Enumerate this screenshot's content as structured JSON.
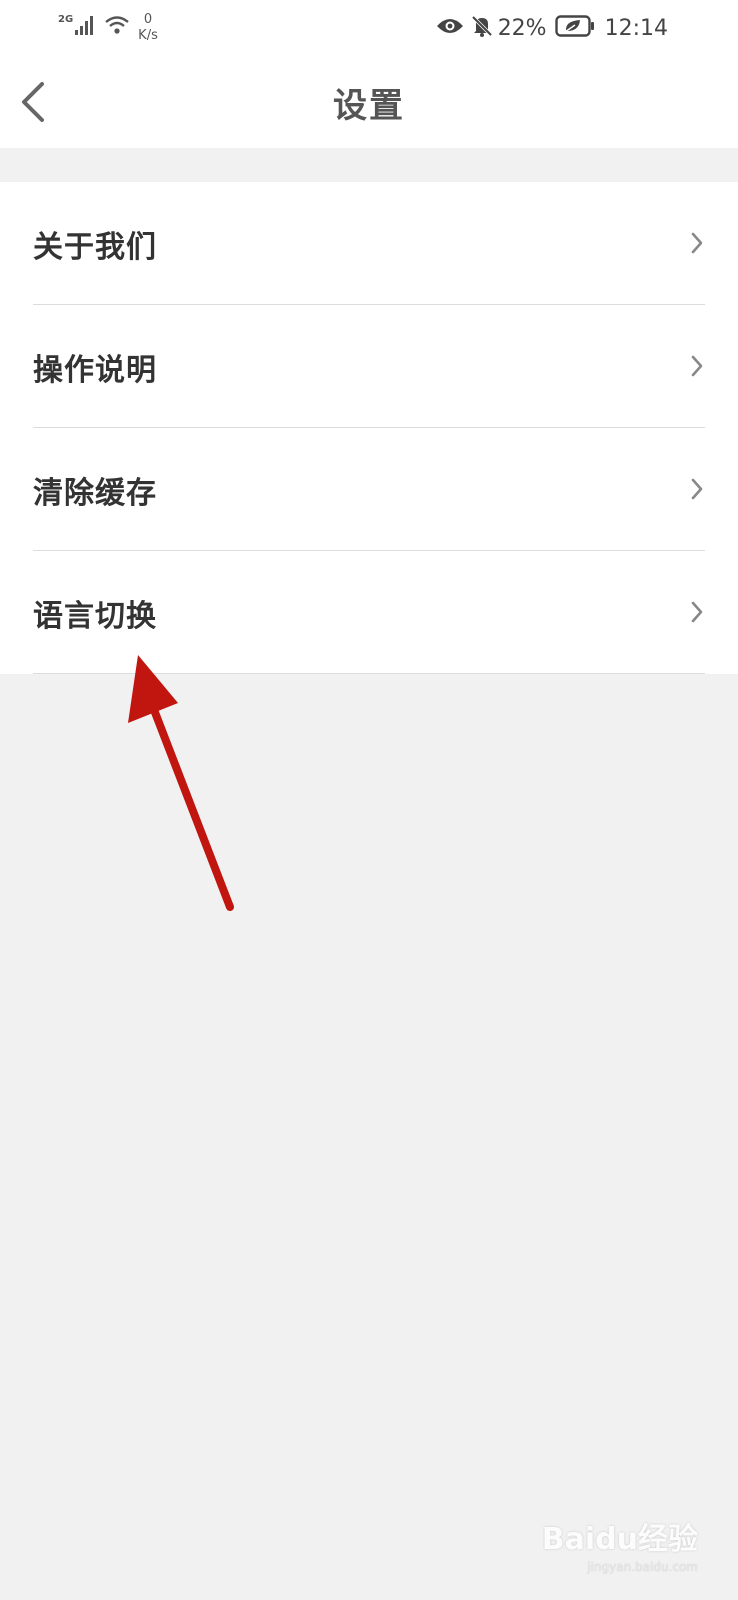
{
  "status_bar": {
    "network_type": "2G",
    "speed_value": "0",
    "speed_unit": "K/s",
    "battery_percent": "22%",
    "time": "12:14",
    "icons": [
      "signal-icon",
      "wifi-icon",
      "eye-icon",
      "bell-off-icon",
      "battery-saver-icon"
    ]
  },
  "header": {
    "title": "设置",
    "back_icon": "chevron-left-icon"
  },
  "settings": {
    "items": [
      {
        "label": "关于我们"
      },
      {
        "label": "操作说明"
      },
      {
        "label": "清除缓存"
      },
      {
        "label": "语言切换"
      }
    ]
  },
  "annotation": {
    "color": "#c0160f",
    "target": "语言切换"
  },
  "watermark": {
    "text": "Baidu经验",
    "sub": "jingyan.baidu.com"
  },
  "colors": {
    "background": "#f1f1f1",
    "surface": "#ffffff",
    "text_primary": "#333333",
    "title": "#555555",
    "divider": "#dcdcdc",
    "arrow": "#c0160f"
  }
}
